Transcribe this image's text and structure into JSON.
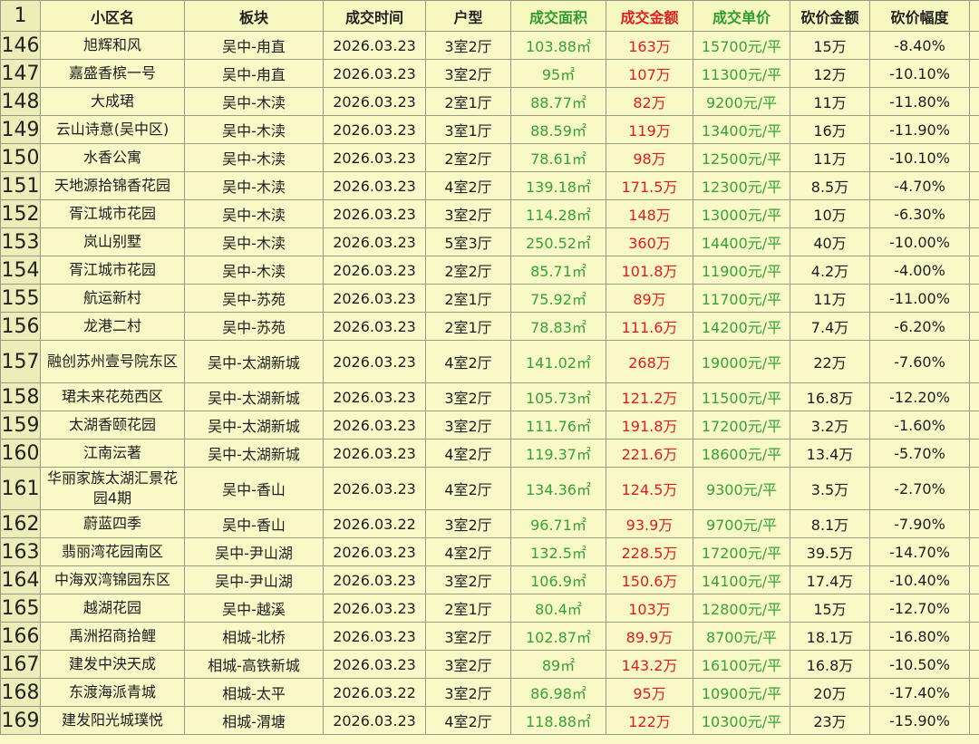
{
  "header": {
    "rownum": "1",
    "name": "小区名",
    "block": "板块",
    "time": "成交时间",
    "type": "户型",
    "area": "成交面积",
    "amount": "成交金额",
    "unit_price": "成交单价",
    "cut_amount": "砍价金额",
    "cut_pct": "砍价幅度"
  },
  "colors": {
    "green": "#35a335",
    "red": "#e01d1d",
    "background": "#f9f9c7"
  },
  "rows": [
    {
      "n": "146",
      "name": "旭辉和风",
      "block": "吴中-甪直",
      "time": "2026.03.23",
      "type": "3室2厅",
      "area": "103.88㎡",
      "amount": "163万",
      "unit": "15700元/平",
      "cut": "15万",
      "pct": "-8.40%"
    },
    {
      "n": "147",
      "name": "嘉盛香槟一号",
      "block": "吴中-甪直",
      "time": "2026.03.23",
      "type": "3室2厅",
      "area": "95㎡",
      "amount": "107万",
      "unit": "11300元/平",
      "cut": "12万",
      "pct": "-10.10%"
    },
    {
      "n": "148",
      "name": "大成珺",
      "block": "吴中-木渎",
      "time": "2026.03.23",
      "type": "2室1厅",
      "area": "88.77㎡",
      "amount": "82万",
      "unit": "9200元/平",
      "cut": "11万",
      "pct": "-11.80%"
    },
    {
      "n": "149",
      "name": "云山诗意(吴中区)",
      "block": "吴中-木渎",
      "time": "2026.03.23",
      "type": "3室1厅",
      "area": "88.59㎡",
      "amount": "119万",
      "unit": "13400元/平",
      "cut": "16万",
      "pct": "-11.90%"
    },
    {
      "n": "150",
      "name": "水香公寓",
      "block": "吴中-木渎",
      "time": "2026.03.23",
      "type": "2室2厅",
      "area": "78.61㎡",
      "amount": "98万",
      "unit": "12500元/平",
      "cut": "11万",
      "pct": "-10.10%"
    },
    {
      "n": "151",
      "name": "天地源拾锦香花园",
      "block": "吴中-木渎",
      "time": "2026.03.23",
      "type": "4室2厅",
      "area": "139.18㎡",
      "amount": "171.5万",
      "unit": "12300元/平",
      "cut": "8.5万",
      "pct": "-4.70%"
    },
    {
      "n": "152",
      "name": "胥江城市花园",
      "block": "吴中-木渎",
      "time": "2026.03.23",
      "type": "3室2厅",
      "area": "114.28㎡",
      "amount": "148万",
      "unit": "13000元/平",
      "cut": "10万",
      "pct": "-6.30%"
    },
    {
      "n": "153",
      "name": "岚山别墅",
      "block": "吴中-木渎",
      "time": "2026.03.23",
      "type": "5室3厅",
      "area": "250.52㎡",
      "amount": "360万",
      "unit": "14400元/平",
      "cut": "40万",
      "pct": "-10.00%"
    },
    {
      "n": "154",
      "name": "胥江城市花园",
      "block": "吴中-木渎",
      "time": "2026.03.23",
      "type": "2室2厅",
      "area": "85.71㎡",
      "amount": "101.8万",
      "unit": "11900元/平",
      "cut": "4.2万",
      "pct": "-4.00%"
    },
    {
      "n": "155",
      "name": "航运新村",
      "block": "吴中-苏苑",
      "time": "2026.03.23",
      "type": "2室1厅",
      "area": "75.92㎡",
      "amount": "89万",
      "unit": "11700元/平",
      "cut": "11万",
      "pct": "-11.00%"
    },
    {
      "n": "156",
      "name": "龙港二村",
      "block": "吴中-苏苑",
      "time": "2026.03.23",
      "type": "2室1厅",
      "area": "78.83㎡",
      "amount": "111.6万",
      "unit": "14200元/平",
      "cut": "7.4万",
      "pct": "-6.20%"
    },
    {
      "n": "157",
      "name": "融创苏州壹号院东区",
      "block": "吴中-太湖新城",
      "time": "2026.03.23",
      "type": "4室2厅",
      "area": "141.02㎡",
      "amount": "268万",
      "unit": "19000元/平",
      "cut": "22万",
      "pct": "-7.60%",
      "tall": true
    },
    {
      "n": "158",
      "name": "珺未来花苑西区",
      "block": "吴中-太湖新城",
      "time": "2026.03.23",
      "type": "3室2厅",
      "area": "105.73㎡",
      "amount": "121.2万",
      "unit": "11500元/平",
      "cut": "16.8万",
      "pct": "-12.20%"
    },
    {
      "n": "159",
      "name": "太湖香颐花园",
      "block": "吴中-太湖新城",
      "time": "2026.03.23",
      "type": "3室2厅",
      "area": "111.76㎡",
      "amount": "191.8万",
      "unit": "17200元/平",
      "cut": "3.2万",
      "pct": "-1.60%"
    },
    {
      "n": "160",
      "name": "江南沄著",
      "block": "吴中-太湖新城",
      "time": "2026.03.23",
      "type": "4室2厅",
      "area": "119.37㎡",
      "amount": "221.6万",
      "unit": "18600元/平",
      "cut": "13.4万",
      "pct": "-5.70%"
    },
    {
      "n": "161",
      "name": "华丽家族太湖汇景花园4期",
      "block": "吴中-香山",
      "time": "2026.03.23",
      "type": "4室2厅",
      "area": "134.36㎡",
      "amount": "124.5万",
      "unit": "9300元/平",
      "cut": "3.5万",
      "pct": "-2.70%",
      "tall": true
    },
    {
      "n": "162",
      "name": "蔚蓝四季",
      "block": "吴中-香山",
      "time": "2026.03.22",
      "type": "3室2厅",
      "area": "96.71㎡",
      "amount": "93.9万",
      "unit": "9700元/平",
      "cut": "8.1万",
      "pct": "-7.90%"
    },
    {
      "n": "163",
      "name": "翡丽湾花园南区",
      "block": "吴中-尹山湖",
      "time": "2026.03.23",
      "type": "4室2厅",
      "area": "132.5㎡",
      "amount": "228.5万",
      "unit": "17200元/平",
      "cut": "39.5万",
      "pct": "-14.70%"
    },
    {
      "n": "164",
      "name": "中海双湾锦园东区",
      "block": "吴中-尹山湖",
      "time": "2026.03.23",
      "type": "3室2厅",
      "area": "106.9㎡",
      "amount": "150.6万",
      "unit": "14100元/平",
      "cut": "17.4万",
      "pct": "-10.40%"
    },
    {
      "n": "165",
      "name": "越湖花园",
      "block": "吴中-越溪",
      "time": "2026.03.23",
      "type": "2室1厅",
      "area": "80.4㎡",
      "amount": "103万",
      "unit": "12800元/平",
      "cut": "15万",
      "pct": "-12.70%"
    },
    {
      "n": "166",
      "name": "禹洲招商拾鲤",
      "block": "相城-北桥",
      "time": "2026.03.23",
      "type": "3室2厅",
      "area": "102.87㎡",
      "amount": "89.9万",
      "unit": "8700元/平",
      "cut": "18.1万",
      "pct": "-16.80%"
    },
    {
      "n": "167",
      "name": "建发中泱天成",
      "block": "相城-高铁新城",
      "time": "2026.03.23",
      "type": "3室2厅",
      "area": "89㎡",
      "amount": "143.2万",
      "unit": "16100元/平",
      "cut": "16.8万",
      "pct": "-10.50%"
    },
    {
      "n": "168",
      "name": "东渡海派青城",
      "block": "相城-太平",
      "time": "2026.03.22",
      "type": "3室2厅",
      "area": "86.98㎡",
      "amount": "95万",
      "unit": "10900元/平",
      "cut": "20万",
      "pct": "-17.40%"
    },
    {
      "n": "169",
      "name": "建发阳光城璞悦",
      "block": "相城-渭塘",
      "time": "2026.03.23",
      "type": "4室2厅",
      "area": "118.88㎡",
      "amount": "122万",
      "unit": "10300元/平",
      "cut": "23万",
      "pct": "-15.90%"
    }
  ]
}
